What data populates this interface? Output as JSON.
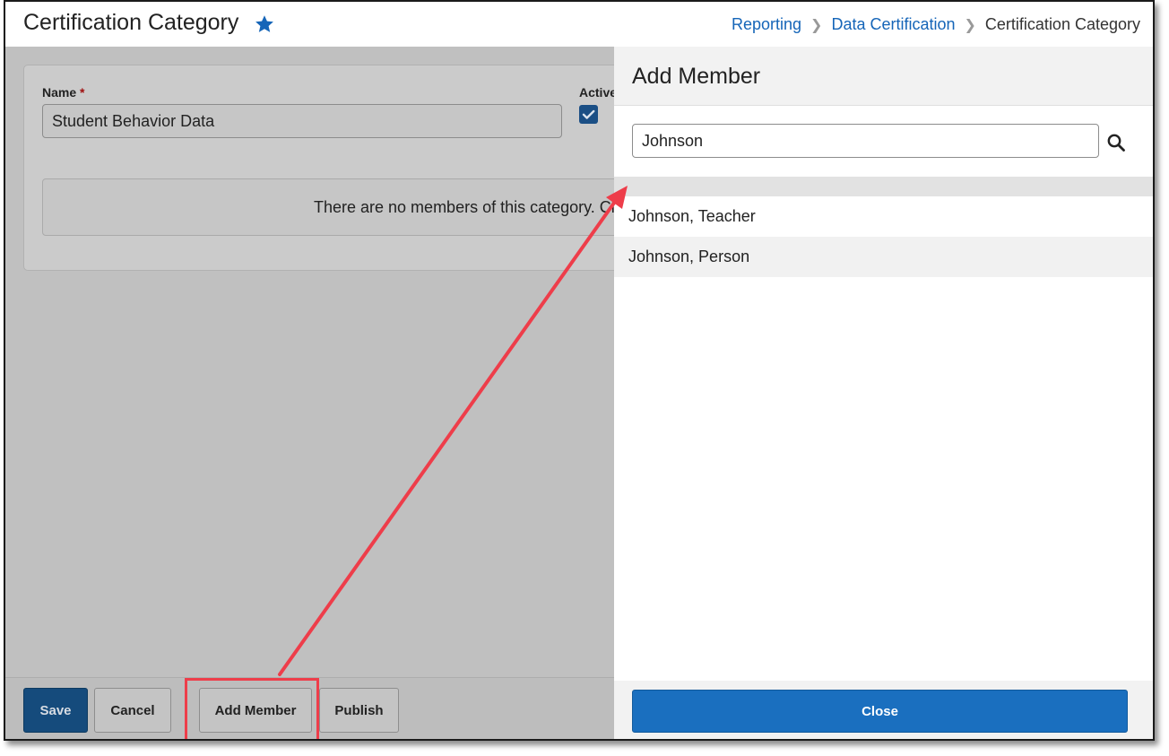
{
  "header": {
    "title": "Certification Category",
    "breadcrumb": [
      "Reporting",
      "Data Certification",
      "Certification Category"
    ]
  },
  "form": {
    "name_label": "Name",
    "required_marker": "*",
    "name_value": "Student Behavior Data",
    "active_label": "Active",
    "active_checked": true,
    "empty_message": "There are no members of this category. Cli"
  },
  "footer": {
    "save": "Save",
    "cancel": "Cancel",
    "add_member": "Add Member",
    "publish": "Publish"
  },
  "panel": {
    "title": "Add Member",
    "search_value": "Johnson",
    "results": [
      "Johnson, Teacher",
      "Johnson, Person"
    ],
    "close": "Close"
  },
  "colors": {
    "primary": "#1a6fbf",
    "link": "#1565b8",
    "save_button": "#154b7c",
    "annotation": "#ee3d4a"
  },
  "icons": [
    "star-icon",
    "chevron-right-icon",
    "checkmark-icon",
    "search-icon"
  ]
}
